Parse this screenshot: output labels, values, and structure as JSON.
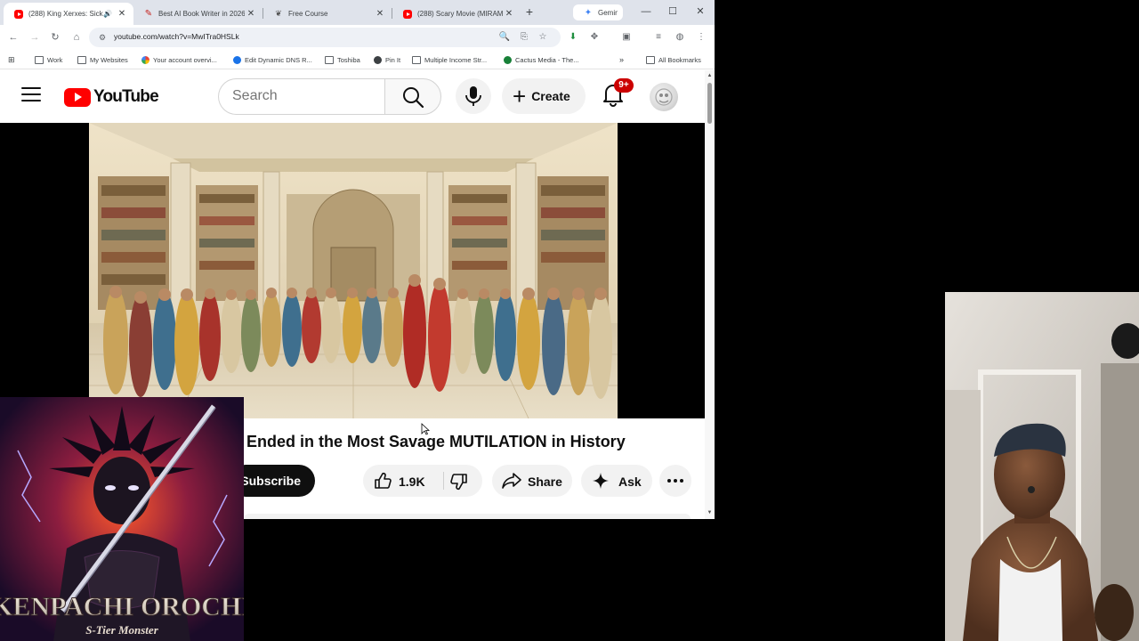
{
  "browser": {
    "tabs": [
      {
        "title": "(288) King Xerxes: Sick",
        "icon": "youtube-icon",
        "active": true,
        "audio": true
      },
      {
        "title": "Best AI Book Writer in 2026",
        "icon": "pen-icon",
        "active": false
      },
      {
        "title": "Free Course",
        "icon": "app-icon",
        "active": false
      },
      {
        "title": "(288) Scary Movie (MIRAM",
        "icon": "youtube-icon",
        "active": false
      },
      {
        "title": "Gemini",
        "icon": "gemini-icon",
        "active": false
      }
    ],
    "url": "youtube.com/watch?v=MwITra0HSLk",
    "bookmarks": [
      {
        "label": "Work"
      },
      {
        "label": "My Websites"
      },
      {
        "label": "Your account overvi..."
      },
      {
        "label": "Edit Dynamic DNS R..."
      },
      {
        "label": "Toshiba"
      },
      {
        "label": "Pin It"
      },
      {
        "label": "Multiple Income Str..."
      },
      {
        "label": "Cactus Media - The..."
      }
    ],
    "all_bookmarks": "All Bookmarks"
  },
  "youtube": {
    "logo_text": "YouTube",
    "search_placeholder": "Search",
    "create_label": "Create",
    "notification_count": "9+",
    "video_title": "Ended in the Most Savage MUTILATION in History",
    "subscribe_label": "Subscribe",
    "like_count": "1.9K",
    "share_label": "Share",
    "ask_label": "Ask"
  },
  "overlays": {
    "album_title": "KENPACHI OROCHI",
    "album_subtitle": "S-Tier Monster"
  },
  "colors": {
    "youtube_red": "#ff0000",
    "badge_red": "#cc0000",
    "tab_strip": "#dfe3eb"
  }
}
